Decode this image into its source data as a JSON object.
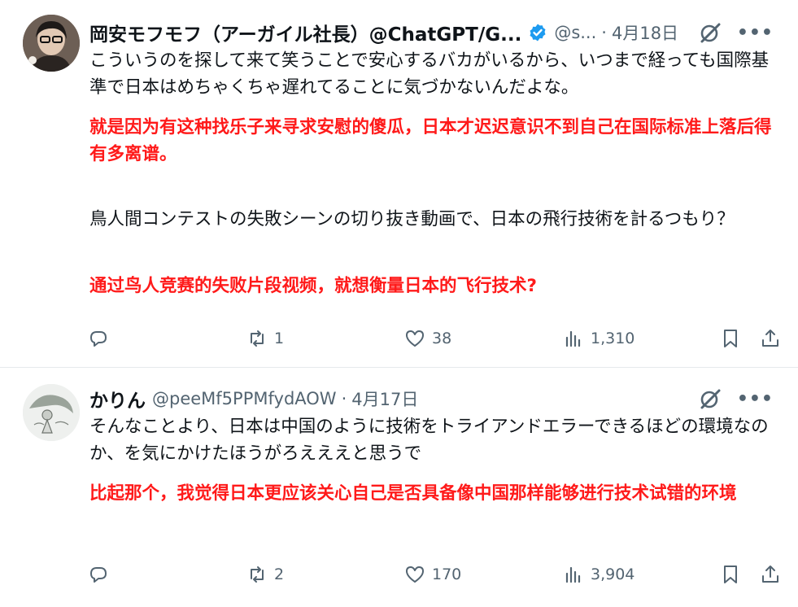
{
  "tweets": [
    {
      "name": "岡安モフモフ（アーガイル社長）@ChatGPT/G...",
      "handle": "@s...",
      "time": "4月18日",
      "jp1": "こういうのを探して来て笑うことで安心するバカがいるから、いつまで経っても国際基準で日本はめちゃくちゃ遅れてることに気づかないんだよな。",
      "cn1": "就是因为有这种找乐子来寻求安慰的傻瓜，日本才迟迟意识不到自己在国际标准上落后得有多离谱。",
      "jp2": "鳥人間コンテストの失敗シーンの切り抜き動画で、日本の飛行技術を計るつもり？",
      "cn2": "通过鸟人竞赛的失败片段视频，就想衡量日本的飞行技术?",
      "reposts": "1",
      "likes": "38",
      "views": "1,310"
    },
    {
      "name": "かりん",
      "handle": "@peeMf5PPMfydAOW",
      "time": "4月17日",
      "jp1": "そんなことより、日本は中国のように技術をトライアンドエラーできるほどの環境なのか、を気にかけたほうがろえええと思うで",
      "cn1": "比起那个，我觉得日本更应该关心自己是否具备像中国那样能够进行技术试错的环境",
      "reposts": "2",
      "likes": "170",
      "views": "3,904"
    }
  ],
  "colors": {
    "accent": "#1d9bf0",
    "muted": "#536471",
    "translation": "#ff1a1a"
  }
}
